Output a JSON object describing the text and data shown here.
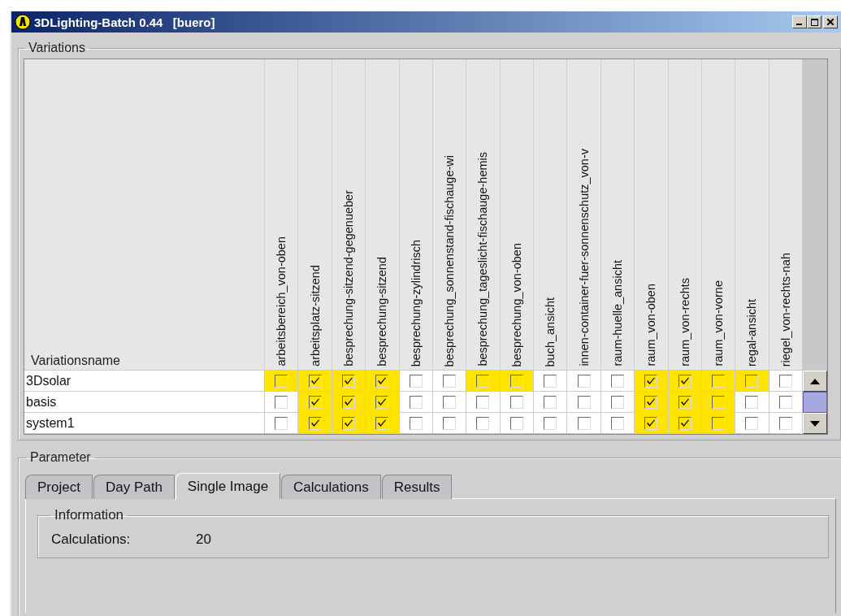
{
  "window": {
    "title": "3DLighting-Batch 0.44   [buero]"
  },
  "variations": {
    "title": "Variations",
    "name_header": "Variationsname",
    "columns": [
      "arbeitsbereich_von-oben",
      "arbeitsplatz-sitzend",
      "besprechung-sitzend-gegenueber",
      "besprechung-sitzend",
      "besprechung-zylindrisch",
      "besprechung_sonnenstand-fischauge-wi",
      "besprechung_tageslicht-fischauge-hemis",
      "besprechung_von-oben",
      "buch_ansicht",
      "innen-container-fuer-sonnenschutz_von-v",
      "raum-huelle_ansicht",
      "raum_von-oben",
      "raum_von-rechts",
      "raum_von-vorne",
      "regal-ansicht",
      "riegel_von-rechts-nah"
    ],
    "rows": [
      {
        "name": "3Dsolar",
        "cells": [
          {
            "checked": false,
            "highlighted": true
          },
          {
            "checked": true,
            "highlighted": true
          },
          {
            "checked": true,
            "highlighted": true
          },
          {
            "checked": true,
            "highlighted": true
          },
          {
            "checked": false,
            "highlighted": false
          },
          {
            "checked": false,
            "highlighted": false
          },
          {
            "checked": false,
            "highlighted": true
          },
          {
            "checked": false,
            "highlighted": true
          },
          {
            "checked": false,
            "highlighted": false
          },
          {
            "checked": false,
            "highlighted": false
          },
          {
            "checked": false,
            "highlighted": false
          },
          {
            "checked": true,
            "highlighted": true
          },
          {
            "checked": true,
            "highlighted": true
          },
          {
            "checked": false,
            "highlighted": true
          },
          {
            "checked": false,
            "highlighted": true
          },
          {
            "checked": false,
            "highlighted": false
          }
        ]
      },
      {
        "name": "basis",
        "cells": [
          {
            "checked": false,
            "highlighted": false
          },
          {
            "checked": true,
            "highlighted": true
          },
          {
            "checked": true,
            "highlighted": true
          },
          {
            "checked": true,
            "highlighted": true
          },
          {
            "checked": false,
            "highlighted": false
          },
          {
            "checked": false,
            "highlighted": false
          },
          {
            "checked": false,
            "highlighted": false
          },
          {
            "checked": false,
            "highlighted": false
          },
          {
            "checked": false,
            "highlighted": false
          },
          {
            "checked": false,
            "highlighted": false
          },
          {
            "checked": false,
            "highlighted": false
          },
          {
            "checked": true,
            "highlighted": true
          },
          {
            "checked": true,
            "highlighted": true
          },
          {
            "checked": false,
            "highlighted": true
          },
          {
            "checked": false,
            "highlighted": false
          },
          {
            "checked": false,
            "highlighted": false
          }
        ]
      },
      {
        "name": "system1",
        "cells": [
          {
            "checked": false,
            "highlighted": false
          },
          {
            "checked": true,
            "highlighted": true
          },
          {
            "checked": true,
            "highlighted": true
          },
          {
            "checked": true,
            "highlighted": true
          },
          {
            "checked": false,
            "highlighted": false
          },
          {
            "checked": false,
            "highlighted": false
          },
          {
            "checked": false,
            "highlighted": false
          },
          {
            "checked": false,
            "highlighted": false
          },
          {
            "checked": false,
            "highlighted": false
          },
          {
            "checked": false,
            "highlighted": false
          },
          {
            "checked": false,
            "highlighted": false
          },
          {
            "checked": true,
            "highlighted": true
          },
          {
            "checked": true,
            "highlighted": true
          },
          {
            "checked": false,
            "highlighted": true
          },
          {
            "checked": false,
            "highlighted": false
          },
          {
            "checked": false,
            "highlighted": false
          }
        ]
      }
    ]
  },
  "parameter": {
    "title": "Parameter",
    "tabs": [
      {
        "label": "Project",
        "selected": false
      },
      {
        "label": "Day Path",
        "selected": false
      },
      {
        "label": "Single Image",
        "selected": true
      },
      {
        "label": "Calculations",
        "selected": false
      },
      {
        "label": "Results",
        "selected": false
      }
    ],
    "information": {
      "title": "Information",
      "label": "Calculations:",
      "value": "20"
    }
  }
}
